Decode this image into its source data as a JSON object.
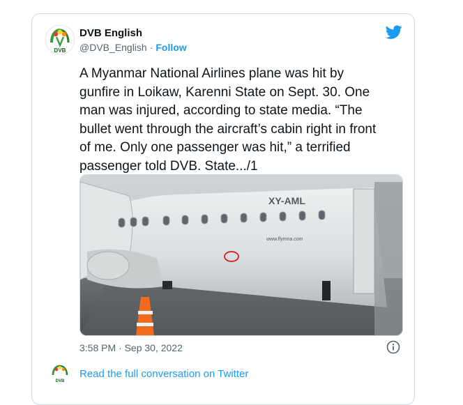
{
  "author": {
    "name": "DVB English",
    "handle": "@DVB_English",
    "separator": "·",
    "follow_label": "Follow",
    "avatar_icon": "dvb-logo-icon"
  },
  "platform_icon": "twitter-bird-icon",
  "tweet": {
    "text": "A Myanmar National Airlines plane was hit by gunfire in Loikaw, Karenni State on Sept. 30. One man was injured, according to state media. “The bullet went through the aircraft’s cabin right in front of me. Only one passenger was hit,” a terrified passenger told DVB. State.../1"
  },
  "photo": {
    "registration": "XY-AML",
    "website": "www.flymna.com"
  },
  "meta": {
    "timestamp": "3:58 PM · Sep 30, 2022",
    "info_icon": "info-icon"
  },
  "footer": {
    "conversation_link": "Read the full conversation on Twitter"
  },
  "colors": {
    "accent": "#1d9bf0",
    "secondary_text": "#536471",
    "border": "#cfd9de"
  }
}
